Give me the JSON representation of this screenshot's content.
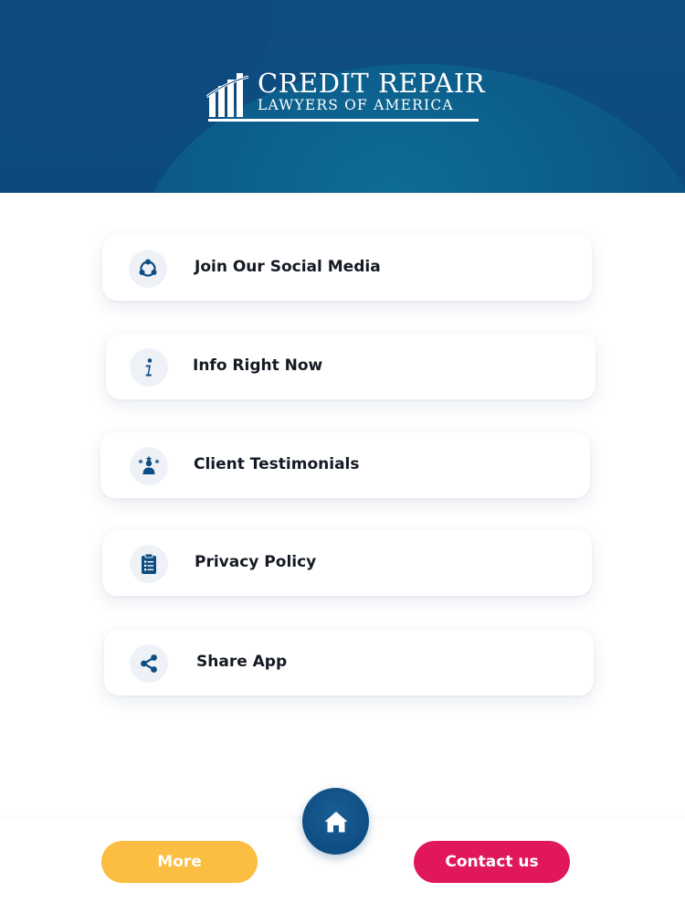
{
  "header": {
    "logo_line1": "CREDIT REPAIR",
    "logo_line2": "LAWYERS OF AMERICA",
    "colors": {
      "background": "#0c4a7e",
      "wave": "#0e6e95"
    }
  },
  "menu": {
    "items": [
      {
        "label": "Join Our Social Media",
        "icon": "social-network-icon"
      },
      {
        "label": "Info Right Now",
        "icon": "info-icon"
      },
      {
        "label": "Client Testimonials",
        "icon": "testimonial-icon"
      },
      {
        "label": "Privacy Policy",
        "icon": "clipboard-icon"
      },
      {
        "label": "Share App",
        "icon": "share-icon"
      }
    ],
    "icon_color": "#0e4d82"
  },
  "bottom_nav": {
    "home_icon": "home-icon",
    "more_label": "More",
    "contact_label": "Contact us",
    "colors": {
      "more": "#fbbe42",
      "contact": "#e0185a",
      "home": "#0e4d82"
    }
  }
}
